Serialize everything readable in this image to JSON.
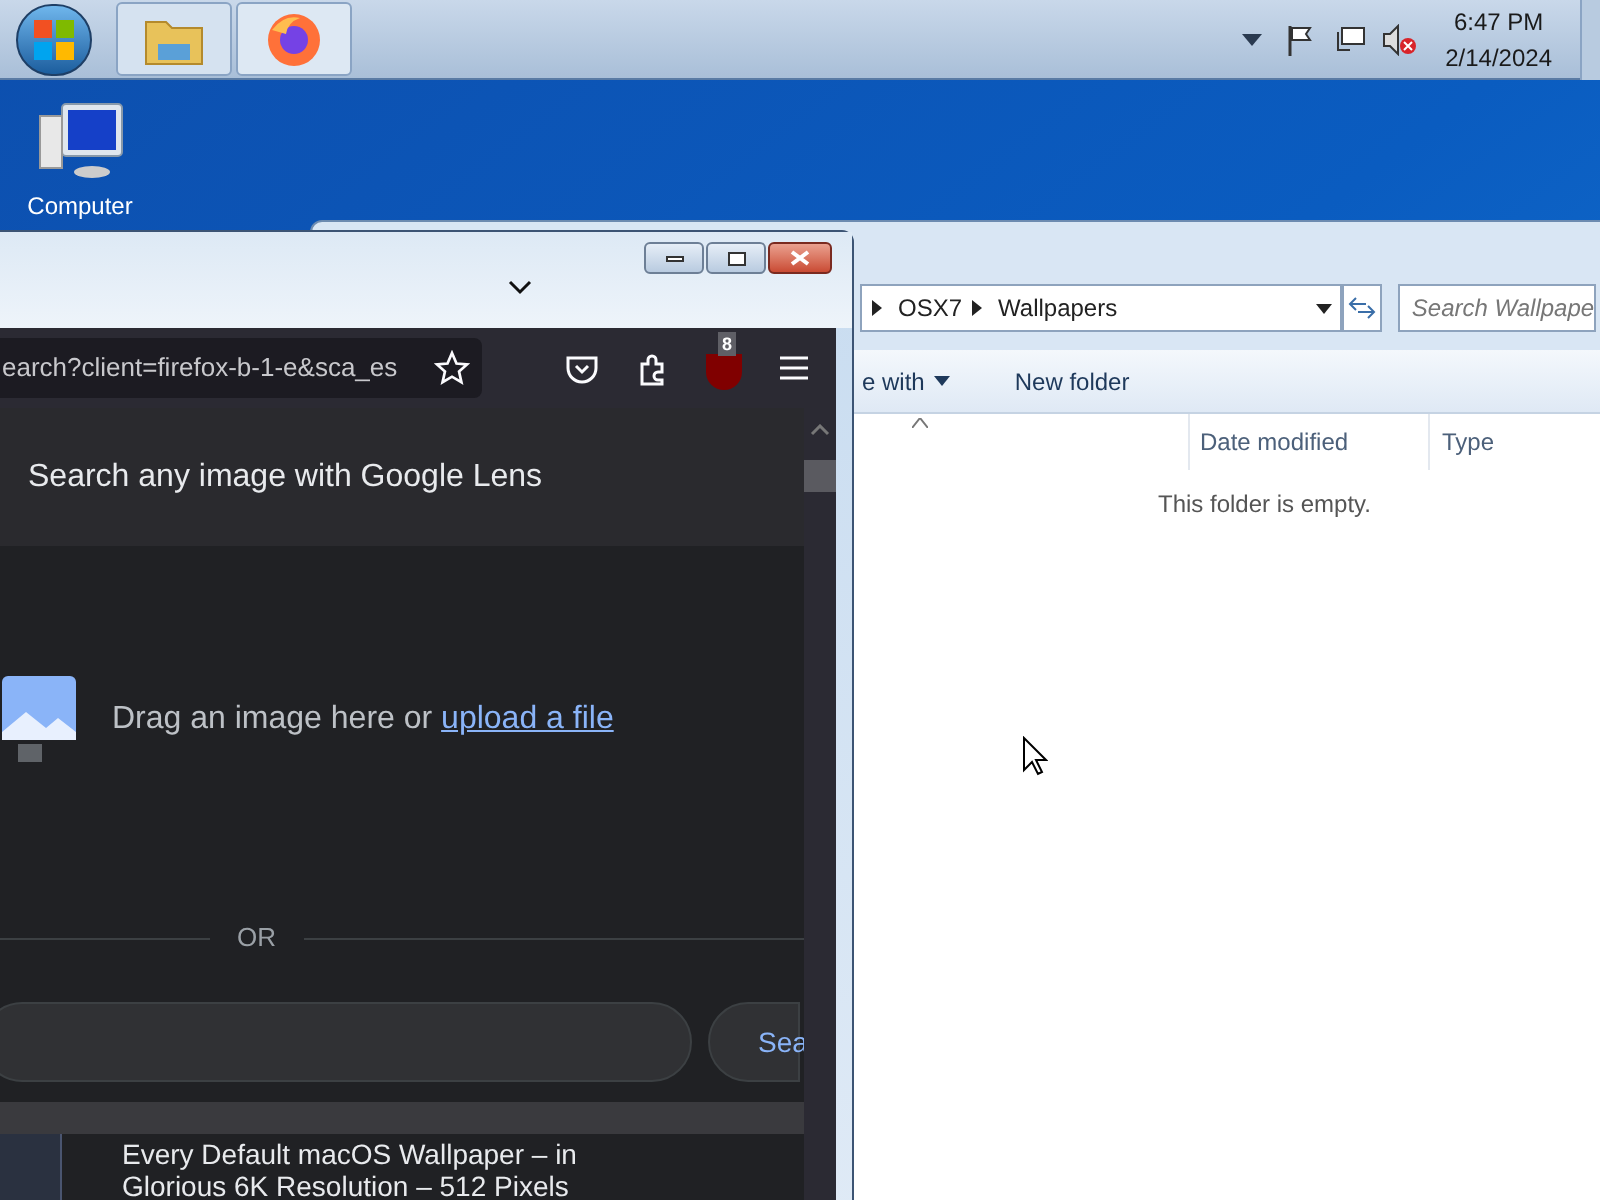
{
  "taskbar": {
    "time": "6:47 PM",
    "date": "2/14/2024"
  },
  "desktop_icons": [
    {
      "label": "Computer"
    }
  ],
  "explorer": {
    "breadcrumb": [
      "OSX7",
      "Wallpapers"
    ],
    "search": {
      "placeholder": "Search Wallpape"
    },
    "toolbar": [
      "e with",
      "New folder"
    ],
    "columns": [
      "Date modified",
      "Type"
    ],
    "empty_message": "This folder is empty."
  },
  "firefox": {
    "url": "earch?client=firefox-b-1-e&sca_es",
    "extension_badge": "8",
    "lens": {
      "title": "Search any image with Google Lens",
      "drop_text": "Drag an image here or",
      "upload_link": "upload a file",
      "divider": "OR",
      "search_button": "Sea"
    },
    "result": {
      "title_lines": [
        "Every Default macOS Wallpaper – in",
        "Glorious 6K Resolution – 512 Pixels"
      ]
    }
  }
}
